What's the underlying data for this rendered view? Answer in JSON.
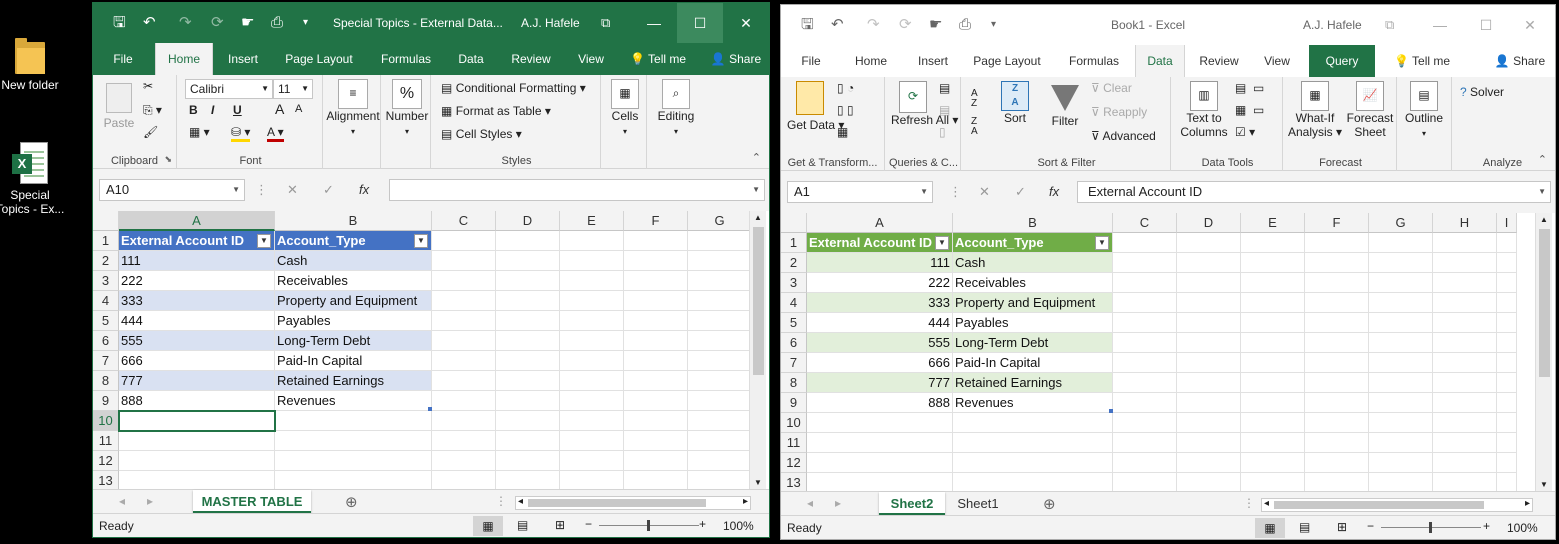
{
  "desktop": {
    "icons": [
      {
        "label": "New folder"
      },
      {
        "label": "Special Topics - Ex..."
      }
    ]
  },
  "left": {
    "title": "Special Topics - External Data...",
    "user": "A.J. Hafele",
    "tabs": [
      "File",
      "Home",
      "Insert",
      "Page Layout",
      "Formulas",
      "Data",
      "Review",
      "View"
    ],
    "tell_me": "Tell me",
    "share": "Share",
    "ribbon": {
      "paste": "Paste",
      "clipboard": "Clipboard",
      "font_name": "Calibri",
      "font_size": "11",
      "font_group": "Font",
      "alignment": "Alignment",
      "number": "Number",
      "cond_format": "Conditional Formatting",
      "format_table": "Format as Table",
      "cell_styles": "Cell Styles",
      "styles": "Styles",
      "cells": "Cells",
      "editing": "Editing",
      "bold": "B",
      "italic": "I",
      "underline": "U",
      "percent": "%",
      "font_color_a": "A",
      "grow_a": "A",
      "shrink_a": "A"
    },
    "name_box": "A10",
    "formula": "",
    "columns": [
      "A",
      "B",
      "C",
      "D",
      "E",
      "F",
      "G"
    ],
    "rows": [
      "1",
      "2",
      "3",
      "4",
      "5",
      "6",
      "7",
      "8",
      "9",
      "10",
      "11",
      "12",
      "13"
    ],
    "headers": [
      "External Account ID",
      "Account_Type"
    ],
    "data": [
      [
        "111",
        "Cash"
      ],
      [
        "222",
        "Receivables"
      ],
      [
        "333",
        "Property and Equipment"
      ],
      [
        "444",
        "Payables"
      ],
      [
        "555",
        "Long-Term Debt"
      ],
      [
        "666",
        "Paid-In Capital"
      ],
      [
        "777",
        "Retained Earnings"
      ],
      [
        "888",
        "Revenues"
      ]
    ],
    "sheets": [
      "MASTER TABLE"
    ],
    "status": "Ready",
    "zoom": "100%"
  },
  "right": {
    "title": "Book1  -  Excel",
    "user": "A.J. Hafele",
    "tabs": [
      "File",
      "Home",
      "Insert",
      "Page Layout",
      "Formulas",
      "Data",
      "Review",
      "View",
      "Query"
    ],
    "tell_me": "Tell me",
    "share": "Share",
    "ribbon": {
      "get_data": "Get Data",
      "get_transform": "Get & Transform...",
      "refresh_all": "Refresh All",
      "queries": "Queries & C...",
      "sort": "Sort",
      "sort_az": "A Z",
      "sort_za": "Z A",
      "filter": "Filter",
      "clear": "Clear",
      "reapply": "Reapply",
      "advanced": "Advanced",
      "sort_filter": "Sort & Filter",
      "text_to_columns": "Text to Columns",
      "data_tools": "Data Tools",
      "what_if": "What-If Analysis",
      "forecast_sheet": "Forecast Sheet",
      "forecast": "Forecast",
      "outline": "Outline",
      "solver": "Solver",
      "analyze": "Analyze"
    },
    "name_box": "A1",
    "formula": "External Account ID",
    "columns": [
      "A",
      "B",
      "C",
      "D",
      "E",
      "F",
      "G",
      "H",
      "I"
    ],
    "rows": [
      "1",
      "2",
      "3",
      "4",
      "5",
      "6",
      "7",
      "8",
      "9",
      "10",
      "11",
      "12",
      "13"
    ],
    "headers": [
      "External Account ID",
      "Account_Type"
    ],
    "data": [
      [
        "111",
        "Cash"
      ],
      [
        "222",
        "Receivables"
      ],
      [
        "333",
        "Property and Equipment"
      ],
      [
        "444",
        "Payables"
      ],
      [
        "555",
        "Long-Term Debt"
      ],
      [
        "666",
        "Paid-In Capital"
      ],
      [
        "777",
        "Retained Earnings"
      ],
      [
        "888",
        "Revenues"
      ]
    ],
    "sheets": [
      "Sheet2",
      "Sheet1"
    ],
    "status": "Ready",
    "zoom": "100%"
  },
  "colors": {
    "excel_green": "#217346",
    "blue_table_header": "#4472c4",
    "blue_band": "#d9e1f2",
    "green_table_header": "#70ad47",
    "green_band": "#e2efda"
  }
}
